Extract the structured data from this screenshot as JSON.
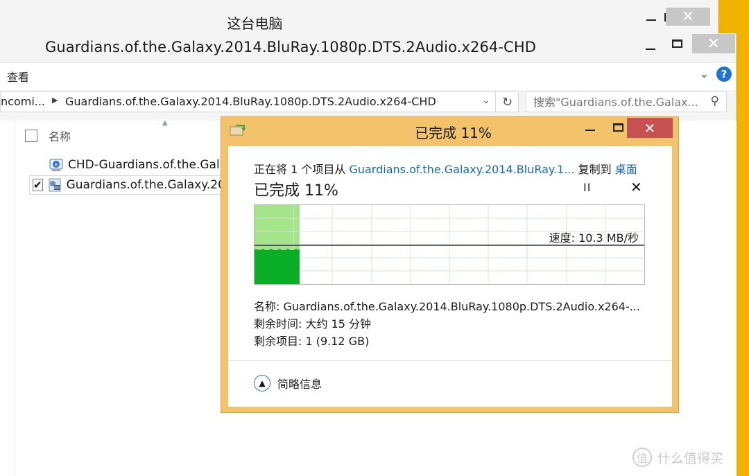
{
  "back_window": {
    "title": "这台电脑",
    "controls": {
      "minimize": "—",
      "maximize": "□",
      "close": "✕"
    }
  },
  "explorer": {
    "title": "Guardians.of.the.Galaxy.2014.BluRay.1080p.DTS.2Audio.x264-CHD",
    "menu": {
      "view_label": "查看",
      "expand_icon": "chevron-down-icon",
      "help_label": "?"
    },
    "address": {
      "crumb_prev": "ncomi...",
      "crumb_current": "Guardians.of.the.Galaxy.2014.BluRay.1080p.DTS.2Audio.x264-CHD"
    },
    "search": {
      "placeholder": "搜索\"Guardians.of.the.Galax..."
    },
    "column_header": {
      "name_label": "名称"
    },
    "files": [
      {
        "name": "CHD-Guardians.of.the.Gala",
        "icon": "url-shortcut-icon",
        "checked": false
      },
      {
        "name": "Guardians.of.the.Galaxy.201",
        "icon": "video-file-icon",
        "checked": true
      }
    ]
  },
  "copy_dialog": {
    "title": "已完成 11%",
    "status_line": {
      "prefix": "正在将 1 个项目从 ",
      "source": "Guardians.of.the.Galaxy.2014.BluRay.1...",
      "middle": " 复制到 ",
      "destination": "桌面"
    },
    "progress_heading": "已完成 11%",
    "progress_percent": 11,
    "pause_label": "II",
    "cancel_label": "✕",
    "speed_label": "速度: 10.3 MB/秒",
    "name_line": "名称:  Guardians.of.the.Galaxy.2014.BluRay.1080p.DTS.2Audio.x264-...",
    "time_remaining": "剩余时间:  大约 15 分钟",
    "items_remaining": "剩余项目:  1 (9.12 GB)",
    "details_label": "简略信息"
  },
  "colors": {
    "dialog_frame": "#f2c36b",
    "progress_dark": "#0bae27",
    "progress_light": "#a6e48c",
    "close_red": "#c75050",
    "link_blue": "#1566c0",
    "desktop_bg": "#f1b300"
  },
  "watermark": {
    "text": "什么值得买",
    "logo": "值"
  }
}
